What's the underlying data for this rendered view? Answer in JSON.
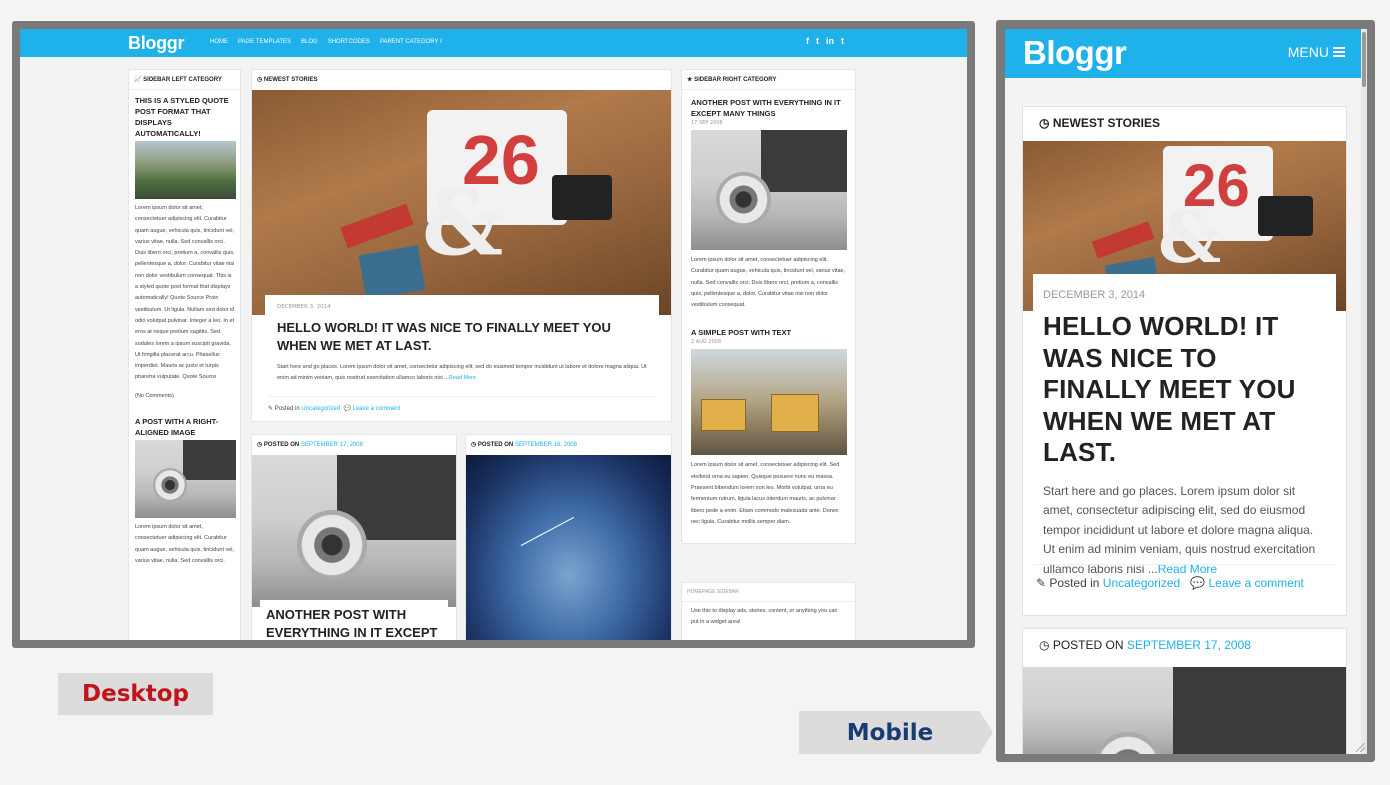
{
  "desktop": {
    "logo": "Bloggr",
    "nav": [
      "HOME",
      "PAGE TEMPLATES",
      "BLOG",
      "SHORTCODES",
      "PARENT CATEGORY I"
    ],
    "social": [
      "f",
      "t",
      "in",
      "t"
    ],
    "left_sidebar": {
      "header": "SIDEBAR LEFT CATEGORY",
      "post1_title": "THIS IS A STYLED QUOTE POST FORMAT THAT DISPLAYS AUTOMATICALLY!",
      "post1_text": "Lorem ipsum dolor sit amet, consectetuer adipiscing elit. Curabitur quam augue, vehicula quis, tincidunt vel, varius vitae, nulla. Sed convallis orci. Duis libero orci, pretium a, convallis quis, pellentesque a, dolor. Curabitur vitae nisi non dolor vestibulum consequat. This is a styled quote post format that displays automatically! Quote Source Proin vestibulum. Ut ligula. Nullam sed dolor id odio volutpat pulvinar. Integer a leo. In et eros at neque pretium sagittis. Sed sodales lorem a ipsum suscipit gravida. Ut fringilla placerat arcu. Phasellus imperdiet. Mauris ac justo et turpis pharetra vulputate. Quote Source",
      "post1_comments": "(No Comments)",
      "post2_title": "A POST WITH A RIGHT-ALIGNED IMAGE",
      "post2_text": "Lorem ipsum dolor sit amet, consectetuer adipiscing elit. Curabitur quam augue, vehicula quis, tincidunt vel, varius vitae, nulla. Sed convallis orci."
    },
    "newest": {
      "header": "NEWEST STORIES",
      "date": "DECEMBER 3, 2014",
      "title": "HELLO WORLD! IT WAS NICE TO FINALLY MEET YOU WHEN WE MET AT LAST.",
      "excerpt": "Start here and go places. Lorem ipsum dolor sit amet, consectetur adipiscing elit, sed do eiusmod tempor incididunt ut labore et dolore magna aliqua. Ut enim ad minim veniam, quis nostrud exercitation ullamco laboris nisi ...",
      "read_more": "Read More",
      "posted_in": "Posted in",
      "category": "Uncategorized",
      "comment": "Leave a comment"
    },
    "card2": {
      "posted_on": "POSTED ON",
      "date": "SEPTEMBER 17, 2008",
      "title": "ANOTHER POST WITH EVERYTHING IN IT EXCEPT"
    },
    "card3": {
      "posted_on": "POSTED ON",
      "date": "SEPTEMBER 16, 2008"
    },
    "right_sidebar": {
      "header": "SIDEBAR RIGHT CATEGORY",
      "post1_title": "ANOTHER POST WITH EVERYTHING IN IT EXCEPT MANY THINGS",
      "post1_date": "17 SEP 2008",
      "post1_text": "Lorem ipsum dolor sit amet, consectetuer adipiscing elit. Curabitur quam augue, vehicula quis, tincidunt vel, varius vitae, nulla. Sed convallis orci. Duis libero orci, pretium a, convallis quis, pellentesque a, dolor. Curabitur vitae nisi non dolor vestibulum consequat.",
      "post2_title": "A SIMPLE POST WITH TEXT",
      "post2_date": "2 AUG 2008",
      "post2_text": "Lorem ipsum dolor sit amet, consectetuer adipiscing elit. Sed eleifend urna eu sapien. Quisque posuere nunc eu massa. Praesent bibendum lorem non leo. Morbi volutpat, urna eu fermentum rutrum, ligula lacus interdum mauris, ac pulvinar libero pede a enim. Etiam commodo malesuada ante. Donec nec ligula. Curabitur mollis semper diam."
    },
    "homepage_sidebar": {
      "header": "HOMEPAGE SIDEBAR",
      "text": "Use this to display ads, stories, content, or anything you can put in a widget area!"
    }
  },
  "labels": {
    "desktop": "Desktop",
    "mobile": "Mobile"
  },
  "mobile": {
    "logo": "Bloggr",
    "menu": "MENU",
    "newest_header": "NEWEST STORIES",
    "date": "DECEMBER 3, 2014",
    "title": "HELLO WORLD! IT WAS NICE TO FINALLY MEET YOU WHEN WE MET AT LAST.",
    "excerpt": "Start here and go places. Lorem ipsum dolor sit amet, consectetur adipiscing elit, sed do eiusmod tempor incididunt ut labore et dolore magna aliqua. Ut enim ad minim veniam, quis nostrud exercitation ullamco laboris nisi ...",
    "read_more": "Read More",
    "posted_in": "Posted in",
    "category": "Uncategorized",
    "comment": "Leave a comment",
    "card2_posted_on": "POSTED ON",
    "card2_date": "SEPTEMBER 17, 2008"
  },
  "colors": {
    "brand": "#1fb1ea",
    "desktop_label": "#c0131a",
    "mobile_label": "#1a3a73"
  }
}
